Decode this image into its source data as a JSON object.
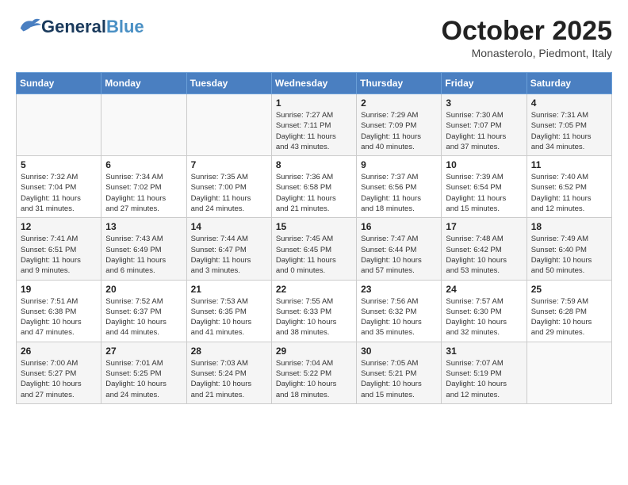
{
  "header": {
    "logo_line1": "General",
    "logo_line2": "Blue",
    "month": "October 2025",
    "location": "Monasterolo, Piedmont, Italy"
  },
  "weekdays": [
    "Sunday",
    "Monday",
    "Tuesday",
    "Wednesday",
    "Thursday",
    "Friday",
    "Saturday"
  ],
  "weeks": [
    [
      {
        "day": "",
        "info": ""
      },
      {
        "day": "",
        "info": ""
      },
      {
        "day": "",
        "info": ""
      },
      {
        "day": "1",
        "info": "Sunrise: 7:27 AM\nSunset: 7:11 PM\nDaylight: 11 hours\nand 43 minutes."
      },
      {
        "day": "2",
        "info": "Sunrise: 7:29 AM\nSunset: 7:09 PM\nDaylight: 11 hours\nand 40 minutes."
      },
      {
        "day": "3",
        "info": "Sunrise: 7:30 AM\nSunset: 7:07 PM\nDaylight: 11 hours\nand 37 minutes."
      },
      {
        "day": "4",
        "info": "Sunrise: 7:31 AM\nSunset: 7:05 PM\nDaylight: 11 hours\nand 34 minutes."
      }
    ],
    [
      {
        "day": "5",
        "info": "Sunrise: 7:32 AM\nSunset: 7:04 PM\nDaylight: 11 hours\nand 31 minutes."
      },
      {
        "day": "6",
        "info": "Sunrise: 7:34 AM\nSunset: 7:02 PM\nDaylight: 11 hours\nand 27 minutes."
      },
      {
        "day": "7",
        "info": "Sunrise: 7:35 AM\nSunset: 7:00 PM\nDaylight: 11 hours\nand 24 minutes."
      },
      {
        "day": "8",
        "info": "Sunrise: 7:36 AM\nSunset: 6:58 PM\nDaylight: 11 hours\nand 21 minutes."
      },
      {
        "day": "9",
        "info": "Sunrise: 7:37 AM\nSunset: 6:56 PM\nDaylight: 11 hours\nand 18 minutes."
      },
      {
        "day": "10",
        "info": "Sunrise: 7:39 AM\nSunset: 6:54 PM\nDaylight: 11 hours\nand 15 minutes."
      },
      {
        "day": "11",
        "info": "Sunrise: 7:40 AM\nSunset: 6:52 PM\nDaylight: 11 hours\nand 12 minutes."
      }
    ],
    [
      {
        "day": "12",
        "info": "Sunrise: 7:41 AM\nSunset: 6:51 PM\nDaylight: 11 hours\nand 9 minutes."
      },
      {
        "day": "13",
        "info": "Sunrise: 7:43 AM\nSunset: 6:49 PM\nDaylight: 11 hours\nand 6 minutes."
      },
      {
        "day": "14",
        "info": "Sunrise: 7:44 AM\nSunset: 6:47 PM\nDaylight: 11 hours\nand 3 minutes."
      },
      {
        "day": "15",
        "info": "Sunrise: 7:45 AM\nSunset: 6:45 PM\nDaylight: 11 hours\nand 0 minutes."
      },
      {
        "day": "16",
        "info": "Sunrise: 7:47 AM\nSunset: 6:44 PM\nDaylight: 10 hours\nand 57 minutes."
      },
      {
        "day": "17",
        "info": "Sunrise: 7:48 AM\nSunset: 6:42 PM\nDaylight: 10 hours\nand 53 minutes."
      },
      {
        "day": "18",
        "info": "Sunrise: 7:49 AM\nSunset: 6:40 PM\nDaylight: 10 hours\nand 50 minutes."
      }
    ],
    [
      {
        "day": "19",
        "info": "Sunrise: 7:51 AM\nSunset: 6:38 PM\nDaylight: 10 hours\nand 47 minutes."
      },
      {
        "day": "20",
        "info": "Sunrise: 7:52 AM\nSunset: 6:37 PM\nDaylight: 10 hours\nand 44 minutes."
      },
      {
        "day": "21",
        "info": "Sunrise: 7:53 AM\nSunset: 6:35 PM\nDaylight: 10 hours\nand 41 minutes."
      },
      {
        "day": "22",
        "info": "Sunrise: 7:55 AM\nSunset: 6:33 PM\nDaylight: 10 hours\nand 38 minutes."
      },
      {
        "day": "23",
        "info": "Sunrise: 7:56 AM\nSunset: 6:32 PM\nDaylight: 10 hours\nand 35 minutes."
      },
      {
        "day": "24",
        "info": "Sunrise: 7:57 AM\nSunset: 6:30 PM\nDaylight: 10 hours\nand 32 minutes."
      },
      {
        "day": "25",
        "info": "Sunrise: 7:59 AM\nSunset: 6:28 PM\nDaylight: 10 hours\nand 29 minutes."
      }
    ],
    [
      {
        "day": "26",
        "info": "Sunrise: 7:00 AM\nSunset: 5:27 PM\nDaylight: 10 hours\nand 27 minutes."
      },
      {
        "day": "27",
        "info": "Sunrise: 7:01 AM\nSunset: 5:25 PM\nDaylight: 10 hours\nand 24 minutes."
      },
      {
        "day": "28",
        "info": "Sunrise: 7:03 AM\nSunset: 5:24 PM\nDaylight: 10 hours\nand 21 minutes."
      },
      {
        "day": "29",
        "info": "Sunrise: 7:04 AM\nSunset: 5:22 PM\nDaylight: 10 hours\nand 18 minutes."
      },
      {
        "day": "30",
        "info": "Sunrise: 7:05 AM\nSunset: 5:21 PM\nDaylight: 10 hours\nand 15 minutes."
      },
      {
        "day": "31",
        "info": "Sunrise: 7:07 AM\nSunset: 5:19 PM\nDaylight: 10 hours\nand 12 minutes."
      },
      {
        "day": "",
        "info": ""
      }
    ]
  ]
}
